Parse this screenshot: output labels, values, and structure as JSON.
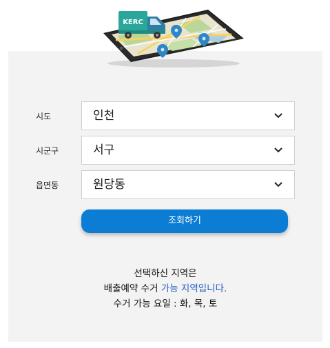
{
  "hero": {
    "truck_logo_text": "KERC"
  },
  "form": {
    "rows": [
      {
        "label": "시도",
        "value": "인천"
      },
      {
        "label": "시군구",
        "value": "서구"
      },
      {
        "label": "읍면동",
        "value": "원당동"
      }
    ],
    "search_button_label": "조회하기"
  },
  "result": {
    "line1": "선택하신 지역은",
    "line2_prefix": "배출예약 수거 ",
    "line2_highlight": "가능 지역입니다.",
    "line3": "수거 가능 요일 : 화, 목, 토"
  },
  "colors": {
    "accent": "#0b7dd4",
    "highlight": "#1f5fbf",
    "panel": "#f3f3f3",
    "truck": "#2aa79b"
  },
  "icons": [
    "tablet-map-illustration",
    "delivery-truck-icon",
    "map-pin-icon",
    "chevron-down-icon"
  ]
}
